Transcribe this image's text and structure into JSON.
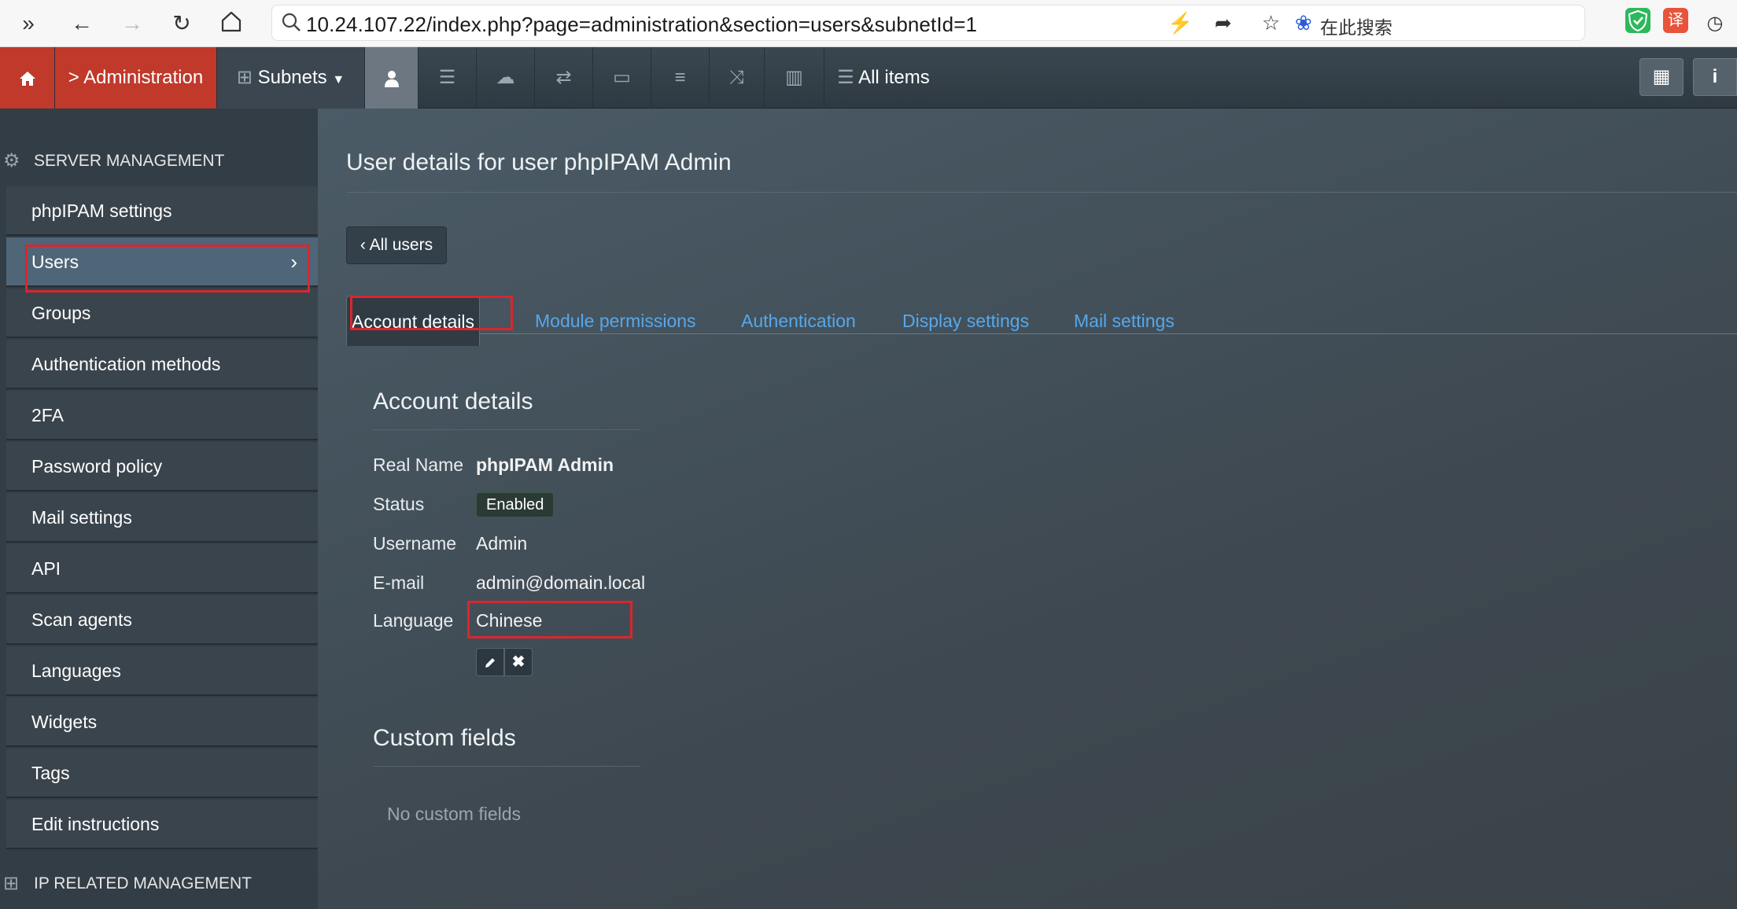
{
  "browser": {
    "url": "10.24.107.22/index.php?page=administration&section=users&subnetId=1",
    "search_engine_label": "在此搜索",
    "translate_ext_label": "译"
  },
  "topnav": {
    "admin_label": "> Administration",
    "subnets_label": "Subnets",
    "all_items_label": "All items"
  },
  "sidebar": {
    "header_server": "SERVER MANAGEMENT",
    "header_ip": "IP RELATED MANAGEMENT",
    "items": [
      {
        "label": "phpIPAM settings"
      },
      {
        "label": "Users"
      },
      {
        "label": "Groups"
      },
      {
        "label": "Authentication methods"
      },
      {
        "label": "2FA"
      },
      {
        "label": "Password policy"
      },
      {
        "label": "Mail settings"
      },
      {
        "label": "API"
      },
      {
        "label": "Scan agents"
      },
      {
        "label": "Languages"
      },
      {
        "label": "Widgets"
      },
      {
        "label": "Tags"
      },
      {
        "label": "Edit instructions"
      }
    ]
  },
  "main": {
    "title": "User details for user phpIPAM Admin",
    "back_label": "All users",
    "tabs": [
      {
        "label": "Account details"
      },
      {
        "label": "Module permissions"
      },
      {
        "label": "Authentication"
      },
      {
        "label": "Display settings"
      },
      {
        "label": "Mail settings"
      }
    ],
    "account": {
      "title": "Account details",
      "real_name_label": "Real Name",
      "real_name": "phpIPAM Admin",
      "status_label": "Status",
      "status": "Enabled",
      "username_label": "Username",
      "username": "Admin",
      "email_label": "E-mail",
      "email": "admin@domain.local",
      "language_label": "Language",
      "language": "Chinese"
    },
    "custom_fields": {
      "title": "Custom fields",
      "empty_text": "No custom fields"
    }
  }
}
